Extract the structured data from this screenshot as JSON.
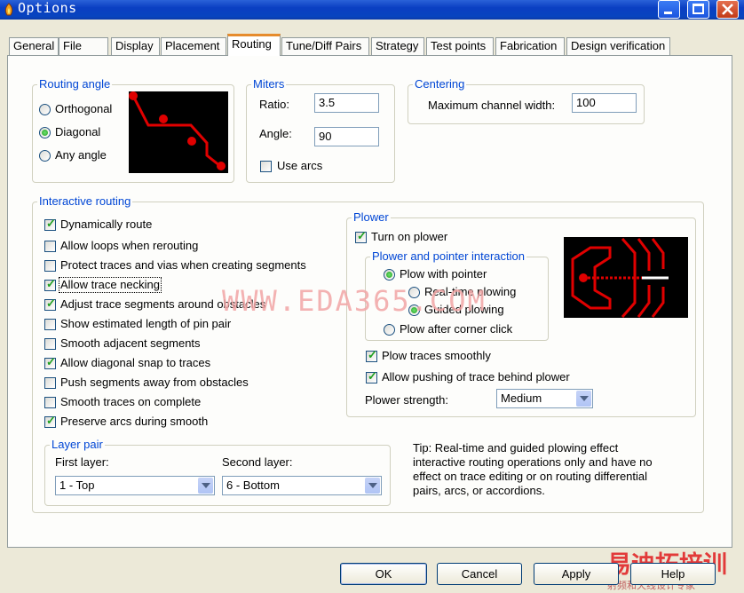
{
  "window": {
    "title": "Options"
  },
  "tabs": [
    "General",
    "File",
    "Display",
    "Placement",
    "Routing",
    "Tune/Diff Pairs",
    "Strategy",
    "Test points",
    "Fabrication",
    "Design verification"
  ],
  "active_tab": "Routing",
  "routing_angle": {
    "legend": "Routing angle",
    "options": [
      "Orthogonal",
      "Diagonal",
      "Any angle"
    ],
    "selected": "Diagonal"
  },
  "miters": {
    "legend": "Miters",
    "ratio_label": "Ratio:",
    "ratio_value": "3.5",
    "angle_label": "Angle:",
    "angle_value": "90",
    "use_arcs_label": "Use arcs",
    "use_arcs_checked": false
  },
  "centering": {
    "legend": "Centering",
    "max_width_label": "Maximum channel width:",
    "max_width_value": "100"
  },
  "interactive_routing": {
    "legend": "Interactive routing",
    "items": [
      {
        "label": "Dynamically route",
        "checked": true
      },
      {
        "label": "Allow loops when rerouting",
        "checked": false
      },
      {
        "label": "Protect traces and vias when creating segments",
        "checked": false
      },
      {
        "label": "Allow trace necking",
        "checked": true
      },
      {
        "label": "Adjust trace segments around obstacles",
        "checked": true
      },
      {
        "label": "Show estimated length of pin pair",
        "checked": false
      },
      {
        "label": "Smooth adjacent segments",
        "checked": false
      },
      {
        "label": "Allow diagonal snap to traces",
        "checked": true
      },
      {
        "label": "Push segments away from obstacles",
        "checked": false
      },
      {
        "label": "Smooth traces on complete",
        "checked": false
      },
      {
        "label": "Preserve arcs during smooth",
        "checked": true
      }
    ]
  },
  "layer_pair": {
    "legend": "Layer pair",
    "first_label": "First layer:",
    "first_value": "1 - Top",
    "second_label": "Second layer:",
    "second_value": "6 - Bottom"
  },
  "plower": {
    "legend": "Plower",
    "turn_on_label": "Turn on plower",
    "turn_on_checked": true,
    "interaction_legend": "Plower and pointer interaction",
    "plow_with_pointer": "Plow with pointer",
    "realtime": "Real-time plowing",
    "guided": "Guided plowing",
    "after_corner": "Plow after corner click",
    "selected_mode": "Plow with pointer",
    "selected_sub": "Guided plowing",
    "smooth_label": "Plow traces smoothly",
    "smooth_checked": true,
    "push_label": "Allow pushing of trace behind plower",
    "push_checked": true,
    "strength_label": "Plower strength:",
    "strength_value": "Medium"
  },
  "tip": "Tip: Real-time and guided plowing effect interactive routing operations only and have no effect on trace editing or on routing differential pairs, arcs, or accordions.",
  "buttons": {
    "ok": "OK",
    "cancel": "Cancel",
    "apply": "Apply",
    "help": "Help"
  },
  "watermark": {
    "main": "WWW.EDA365.COM",
    "logo": "易迪拓培训",
    "sub": "射频和天线设计专家"
  },
  "colors": {
    "accent": "#0046d5",
    "tab_highlight": "#e68b2c",
    "trace_red": "#e00000",
    "titlebar": "#0a3fc2"
  }
}
